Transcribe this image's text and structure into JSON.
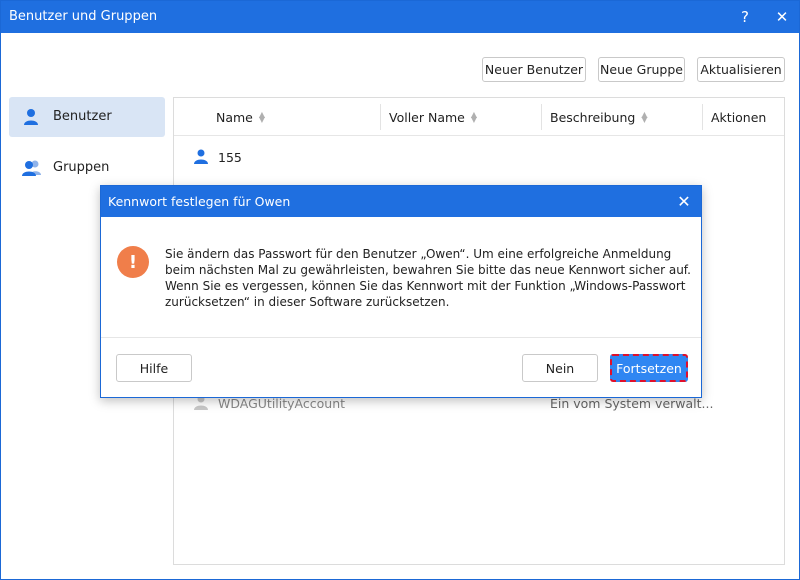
{
  "window": {
    "title": "Benutzer und Gruppen",
    "help_label": "?",
    "close_label": "✕"
  },
  "toolbar": {
    "new_user_label": "Neuer Benutzer",
    "new_group_label": "Neue Gruppe",
    "refresh_label": "Aktualisieren"
  },
  "sidebar": {
    "items": [
      {
        "label": "Benutzer",
        "icon": "user-icon",
        "active": true
      },
      {
        "label": "Gruppen",
        "icon": "group-icon",
        "active": false
      }
    ]
  },
  "table": {
    "columns": [
      "Name",
      "Voller Name",
      "Beschreibung",
      "Aktionen"
    ],
    "rows": [
      {
        "name": "155",
        "full_name": "",
        "description": ""
      },
      {
        "name": "WDAGUtilityAccount",
        "full_name": "",
        "description": "Ein vom System verwalt..."
      }
    ]
  },
  "dialog": {
    "title": "Kennwort festlegen für Owen",
    "close_label": "✕",
    "warning_symbol": "!",
    "message": "Sie ändern das Passwort für den Benutzer „Owen“. Um eine erfolgreiche Anmeldung beim nächsten Mal zu gewährleisten, bewahren Sie bitte das neue Kennwort sicher auf. Wenn Sie es vergessen, können Sie das Kennwort mit der Funktion „Windows-Passwort zurücksetzen“ in dieser Software zurücksetzen.",
    "help_label": "Hilfe",
    "no_label": "Nein",
    "continue_label": "Fortsetzen"
  },
  "colors": {
    "accent": "#1f6fe0",
    "warning": "#f07e4a",
    "highlight_border": "#e0102b",
    "sidebar_active": "#d9e5f5"
  }
}
